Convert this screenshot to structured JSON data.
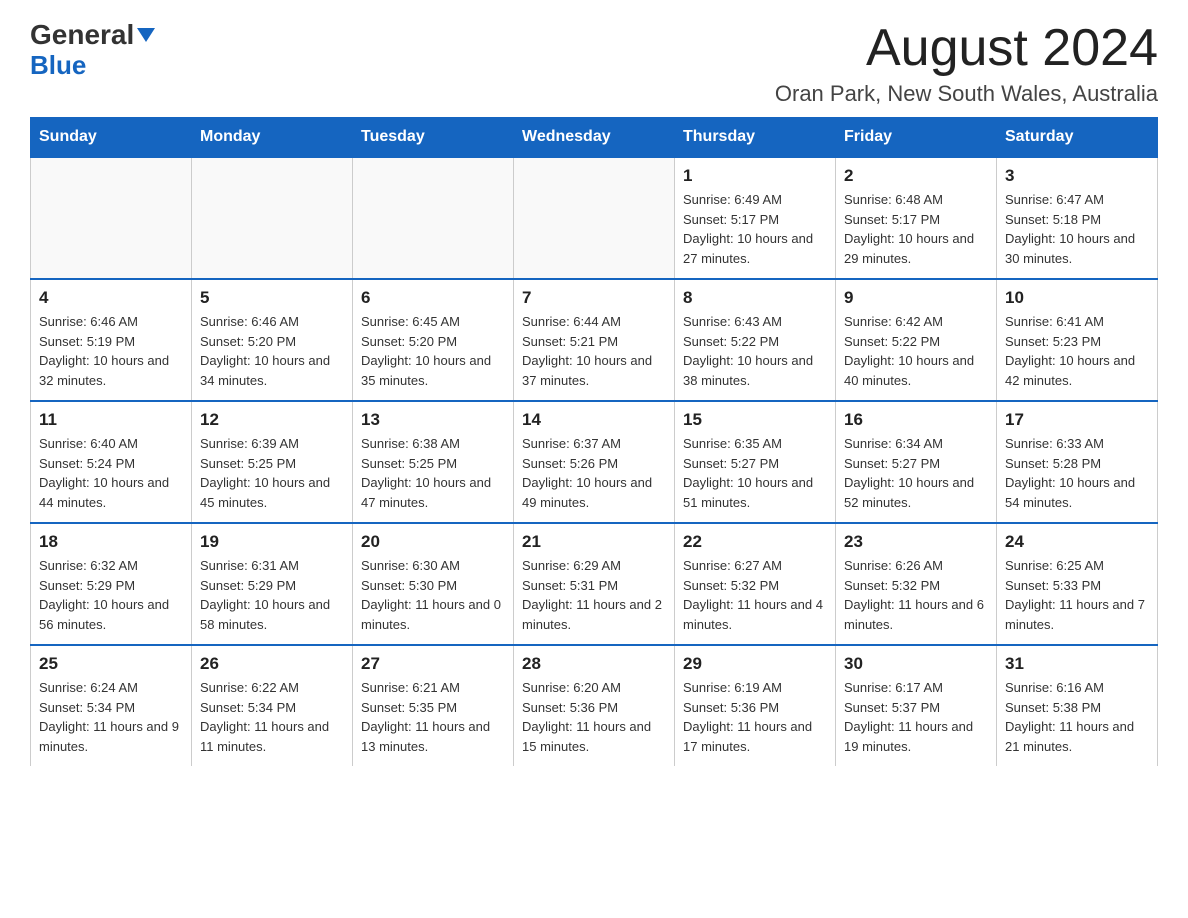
{
  "header": {
    "logo_general": "General",
    "logo_blue": "Blue",
    "month_title": "August 2024",
    "location": "Oran Park, New South Wales, Australia"
  },
  "calendar": {
    "days_of_week": [
      "Sunday",
      "Monday",
      "Tuesday",
      "Wednesday",
      "Thursday",
      "Friday",
      "Saturday"
    ],
    "weeks": [
      [
        {
          "day": "",
          "info": ""
        },
        {
          "day": "",
          "info": ""
        },
        {
          "day": "",
          "info": ""
        },
        {
          "day": "",
          "info": ""
        },
        {
          "day": "1",
          "info": "Sunrise: 6:49 AM\nSunset: 5:17 PM\nDaylight: 10 hours and 27 minutes."
        },
        {
          "day": "2",
          "info": "Sunrise: 6:48 AM\nSunset: 5:17 PM\nDaylight: 10 hours and 29 minutes."
        },
        {
          "day": "3",
          "info": "Sunrise: 6:47 AM\nSunset: 5:18 PM\nDaylight: 10 hours and 30 minutes."
        }
      ],
      [
        {
          "day": "4",
          "info": "Sunrise: 6:46 AM\nSunset: 5:19 PM\nDaylight: 10 hours and 32 minutes."
        },
        {
          "day": "5",
          "info": "Sunrise: 6:46 AM\nSunset: 5:20 PM\nDaylight: 10 hours and 34 minutes."
        },
        {
          "day": "6",
          "info": "Sunrise: 6:45 AM\nSunset: 5:20 PM\nDaylight: 10 hours and 35 minutes."
        },
        {
          "day": "7",
          "info": "Sunrise: 6:44 AM\nSunset: 5:21 PM\nDaylight: 10 hours and 37 minutes."
        },
        {
          "day": "8",
          "info": "Sunrise: 6:43 AM\nSunset: 5:22 PM\nDaylight: 10 hours and 38 minutes."
        },
        {
          "day": "9",
          "info": "Sunrise: 6:42 AM\nSunset: 5:22 PM\nDaylight: 10 hours and 40 minutes."
        },
        {
          "day": "10",
          "info": "Sunrise: 6:41 AM\nSunset: 5:23 PM\nDaylight: 10 hours and 42 minutes."
        }
      ],
      [
        {
          "day": "11",
          "info": "Sunrise: 6:40 AM\nSunset: 5:24 PM\nDaylight: 10 hours and 44 minutes."
        },
        {
          "day": "12",
          "info": "Sunrise: 6:39 AM\nSunset: 5:25 PM\nDaylight: 10 hours and 45 minutes."
        },
        {
          "day": "13",
          "info": "Sunrise: 6:38 AM\nSunset: 5:25 PM\nDaylight: 10 hours and 47 minutes."
        },
        {
          "day": "14",
          "info": "Sunrise: 6:37 AM\nSunset: 5:26 PM\nDaylight: 10 hours and 49 minutes."
        },
        {
          "day": "15",
          "info": "Sunrise: 6:35 AM\nSunset: 5:27 PM\nDaylight: 10 hours and 51 minutes."
        },
        {
          "day": "16",
          "info": "Sunrise: 6:34 AM\nSunset: 5:27 PM\nDaylight: 10 hours and 52 minutes."
        },
        {
          "day": "17",
          "info": "Sunrise: 6:33 AM\nSunset: 5:28 PM\nDaylight: 10 hours and 54 minutes."
        }
      ],
      [
        {
          "day": "18",
          "info": "Sunrise: 6:32 AM\nSunset: 5:29 PM\nDaylight: 10 hours and 56 minutes."
        },
        {
          "day": "19",
          "info": "Sunrise: 6:31 AM\nSunset: 5:29 PM\nDaylight: 10 hours and 58 minutes."
        },
        {
          "day": "20",
          "info": "Sunrise: 6:30 AM\nSunset: 5:30 PM\nDaylight: 11 hours and 0 minutes."
        },
        {
          "day": "21",
          "info": "Sunrise: 6:29 AM\nSunset: 5:31 PM\nDaylight: 11 hours and 2 minutes."
        },
        {
          "day": "22",
          "info": "Sunrise: 6:27 AM\nSunset: 5:32 PM\nDaylight: 11 hours and 4 minutes."
        },
        {
          "day": "23",
          "info": "Sunrise: 6:26 AM\nSunset: 5:32 PM\nDaylight: 11 hours and 6 minutes."
        },
        {
          "day": "24",
          "info": "Sunrise: 6:25 AM\nSunset: 5:33 PM\nDaylight: 11 hours and 7 minutes."
        }
      ],
      [
        {
          "day": "25",
          "info": "Sunrise: 6:24 AM\nSunset: 5:34 PM\nDaylight: 11 hours and 9 minutes."
        },
        {
          "day": "26",
          "info": "Sunrise: 6:22 AM\nSunset: 5:34 PM\nDaylight: 11 hours and 11 minutes."
        },
        {
          "day": "27",
          "info": "Sunrise: 6:21 AM\nSunset: 5:35 PM\nDaylight: 11 hours and 13 minutes."
        },
        {
          "day": "28",
          "info": "Sunrise: 6:20 AM\nSunset: 5:36 PM\nDaylight: 11 hours and 15 minutes."
        },
        {
          "day": "29",
          "info": "Sunrise: 6:19 AM\nSunset: 5:36 PM\nDaylight: 11 hours and 17 minutes."
        },
        {
          "day": "30",
          "info": "Sunrise: 6:17 AM\nSunset: 5:37 PM\nDaylight: 11 hours and 19 minutes."
        },
        {
          "day": "31",
          "info": "Sunrise: 6:16 AM\nSunset: 5:38 PM\nDaylight: 11 hours and 21 minutes."
        }
      ]
    ]
  }
}
